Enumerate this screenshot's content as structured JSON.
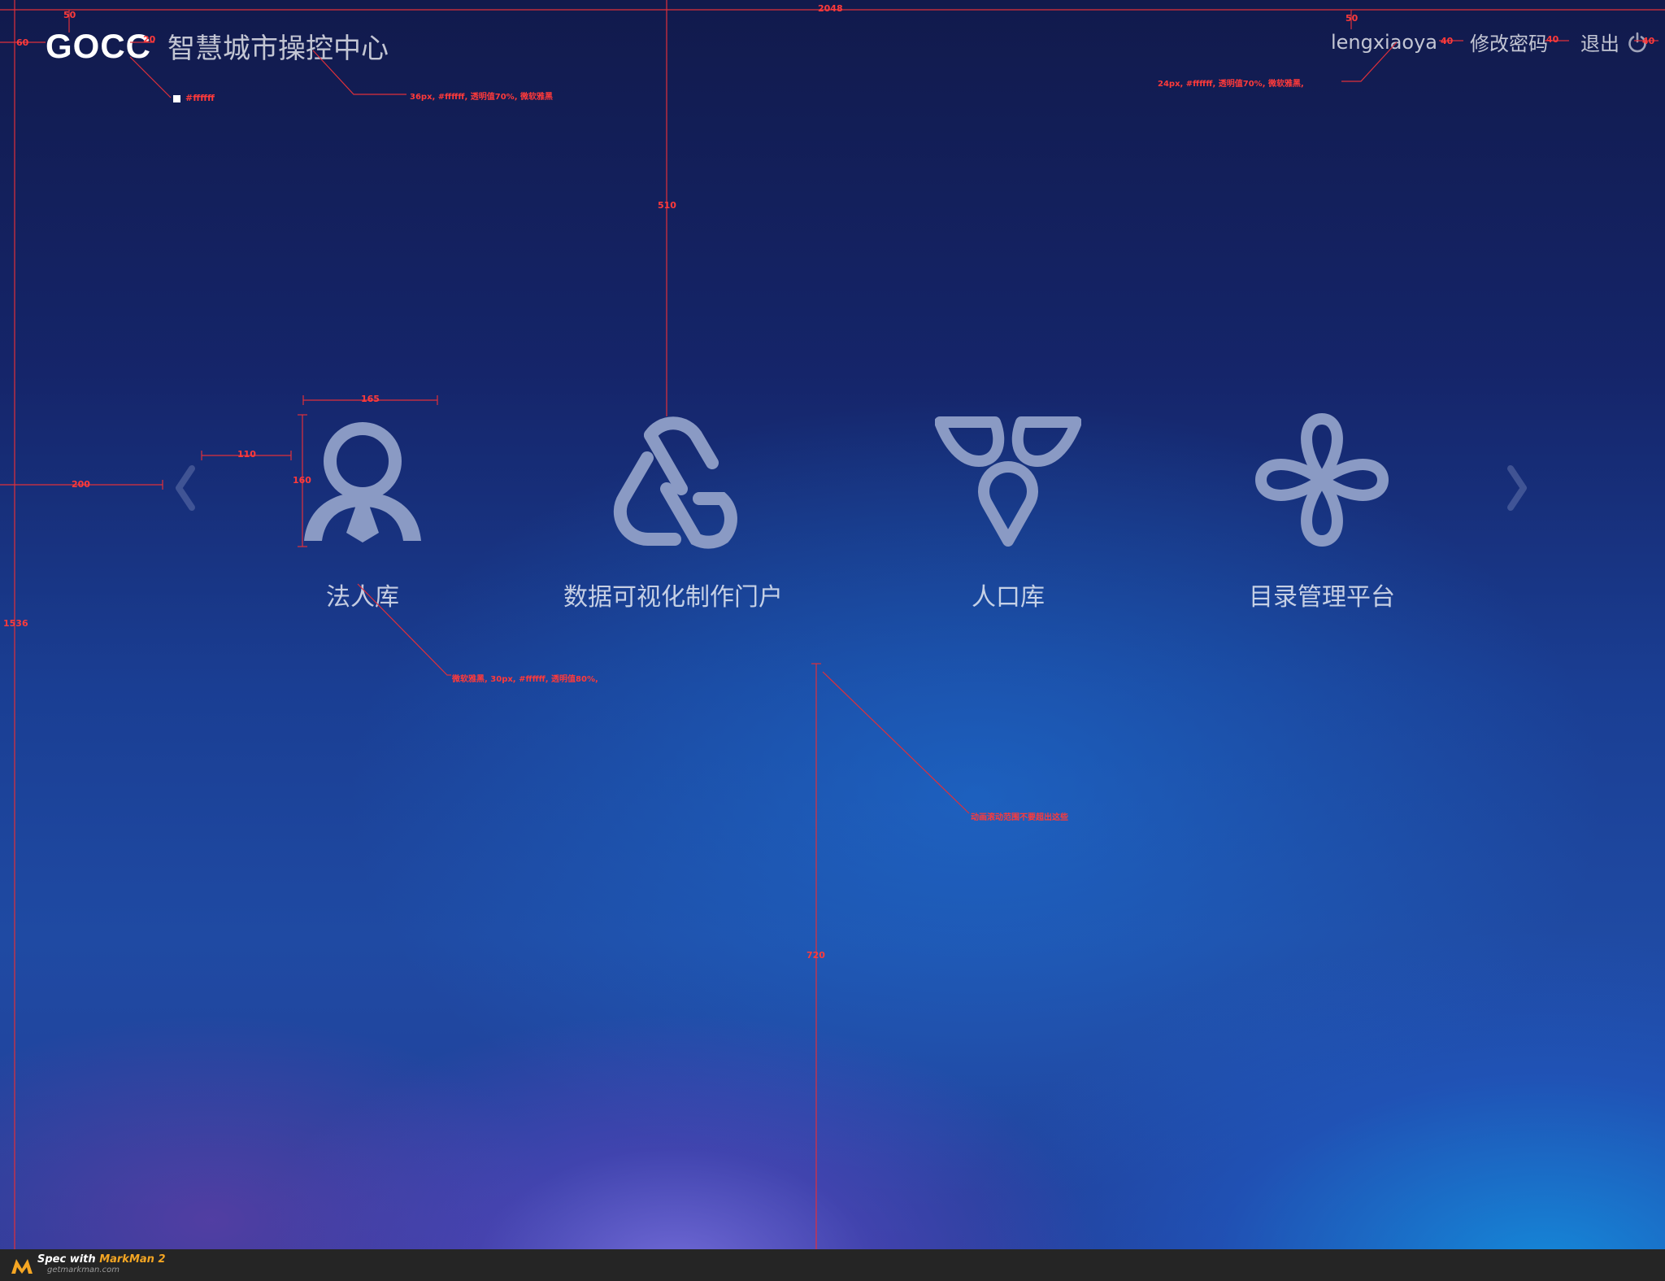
{
  "header": {
    "brand_en": "GOCC",
    "brand_cn": "智慧城市操控中心",
    "username": "lengxiaoya",
    "change_password": "修改密码",
    "logout": "退出"
  },
  "tiles": [
    {
      "label": "法人库",
      "icon": "person-icon"
    },
    {
      "label": "数据可视化制作门户",
      "icon": "link-icon"
    },
    {
      "label": "人口库",
      "icon": "triad-icon"
    },
    {
      "label": "目录管理平台",
      "icon": "clover-icon"
    }
  ],
  "spec": {
    "w2048": "2048",
    "m50a": "50",
    "m50b": "50",
    "m60": "60",
    "m20": "20",
    "swatch": "#ffffff",
    "note_title": "36px, #ffffff, 透明值70%, 微软雅黑",
    "note_user": "24px, #ffffff, 透明值70%, 微软雅黑,",
    "m40a": "40",
    "m40b": "40",
    "m40c": "40",
    "m510": "510",
    "m165": "165",
    "m110": "110",
    "m160": "160",
    "m200": "200",
    "m1536": "1536",
    "note_label": "微软雅黑, 30px, #ffffff, 透明值80%,",
    "note_anim": "动画滚动范围不要超出这些",
    "m720": "720"
  },
  "footer": {
    "prefix": "Spec with ",
    "brand": "MarkMan 2",
    "url": "getmarkman.com"
  },
  "colors": {
    "accent_red": "#ff3a3a",
    "icon_fill": "#8a9ac4",
    "footer_bg": "#252525"
  }
}
